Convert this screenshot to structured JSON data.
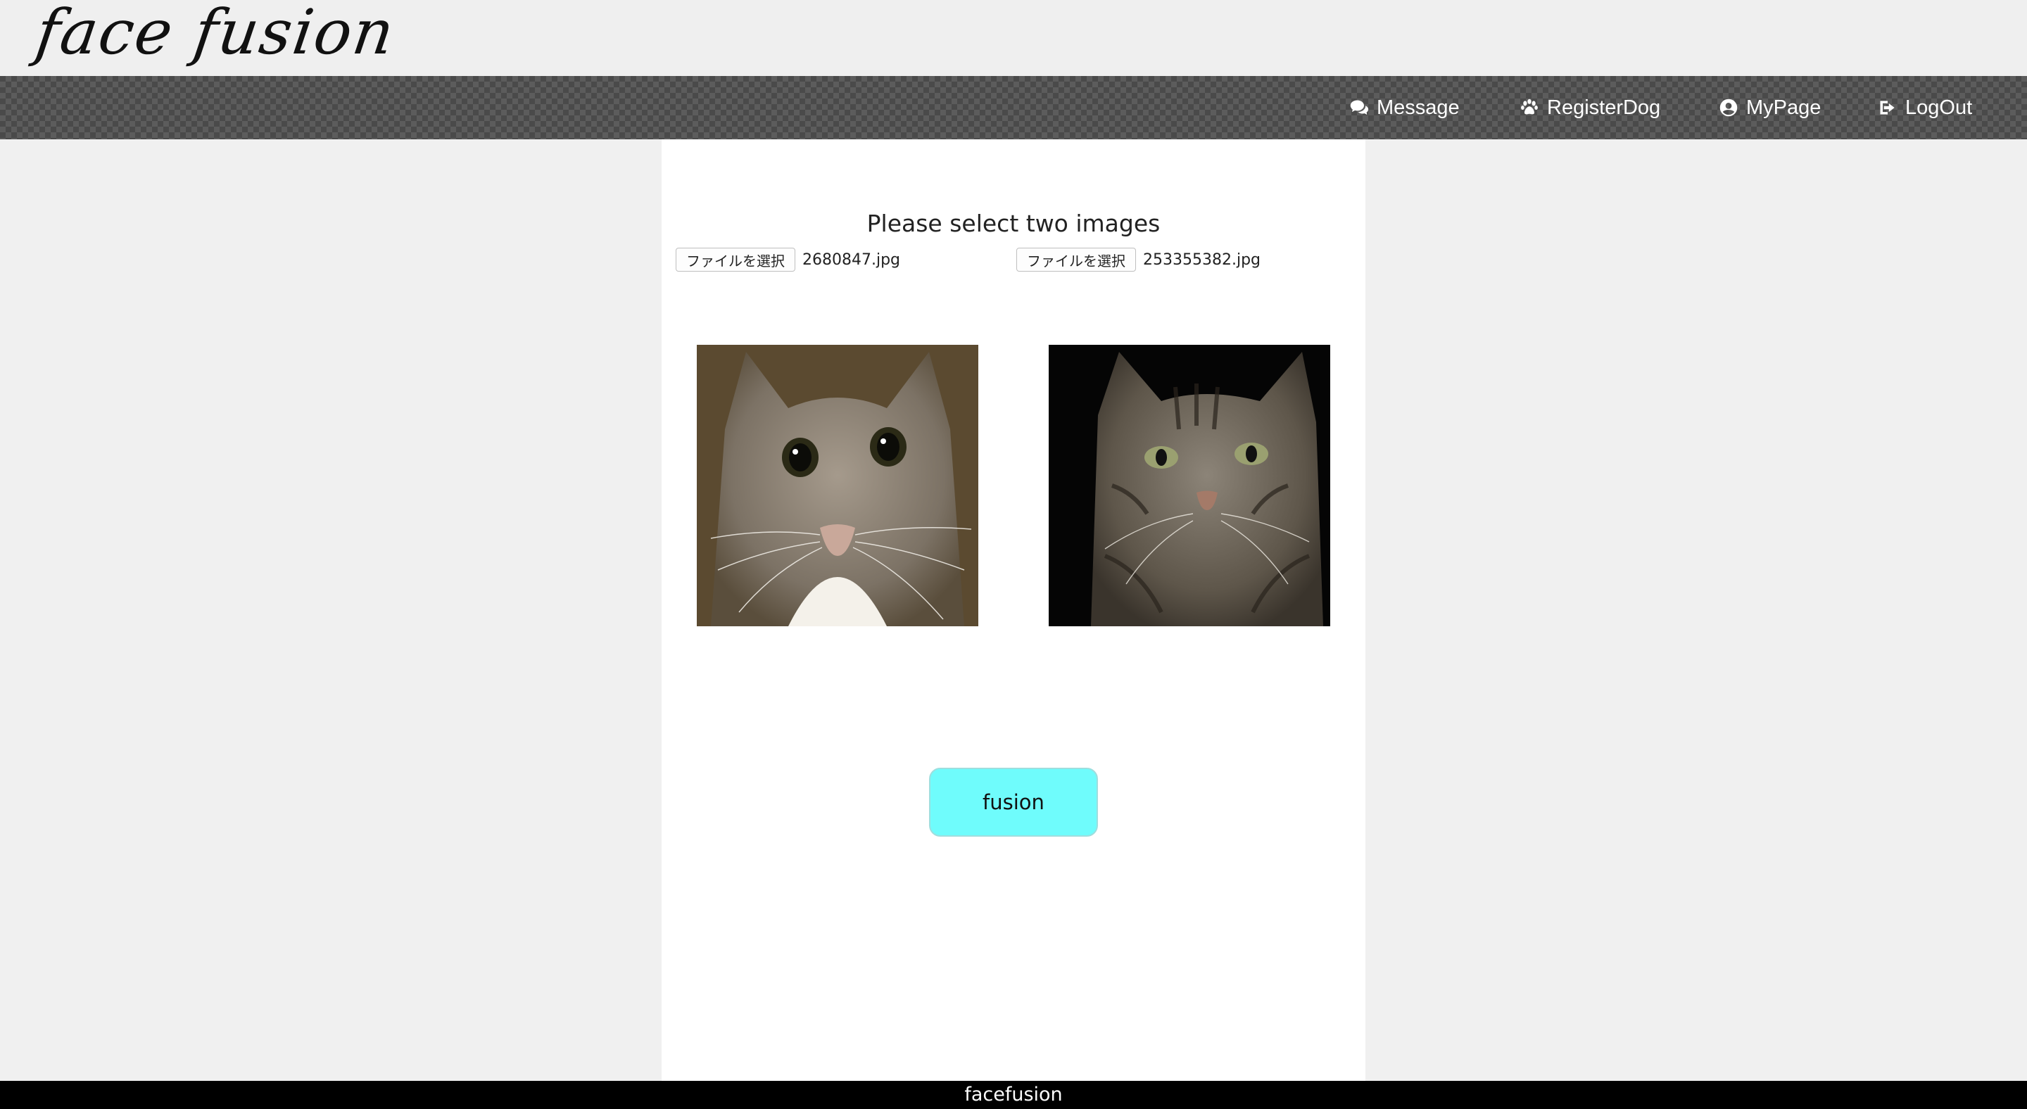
{
  "brand": {
    "logo_text": "face fusion"
  },
  "nav": {
    "items": [
      {
        "label": "Message",
        "icon": "comments-icon"
      },
      {
        "label": "RegisterDog",
        "icon": "paw-icon"
      },
      {
        "label": "MyPage",
        "icon": "user-circle-icon"
      },
      {
        "label": "LogOut",
        "icon": "sign-out-icon"
      }
    ]
  },
  "main": {
    "heading": "Please select two images",
    "file_inputs": [
      {
        "button_label": "ファイルを選択",
        "file_name": "2680847.jpg"
      },
      {
        "button_label": "ファイルを選択",
        "file_name": "253355382.jpg"
      }
    ],
    "images": [
      {
        "alt": "cat photo 1"
      },
      {
        "alt": "cat photo 2"
      }
    ],
    "fusion_button": {
      "label": "fusion",
      "color": "#6ffcfc"
    }
  },
  "footer": {
    "text": "facefusion"
  },
  "colors": {
    "page_bg": "#f0f0f0",
    "main_bg": "#ffffff",
    "footer_bg": "#000000",
    "nav_text": "#ffffff"
  }
}
